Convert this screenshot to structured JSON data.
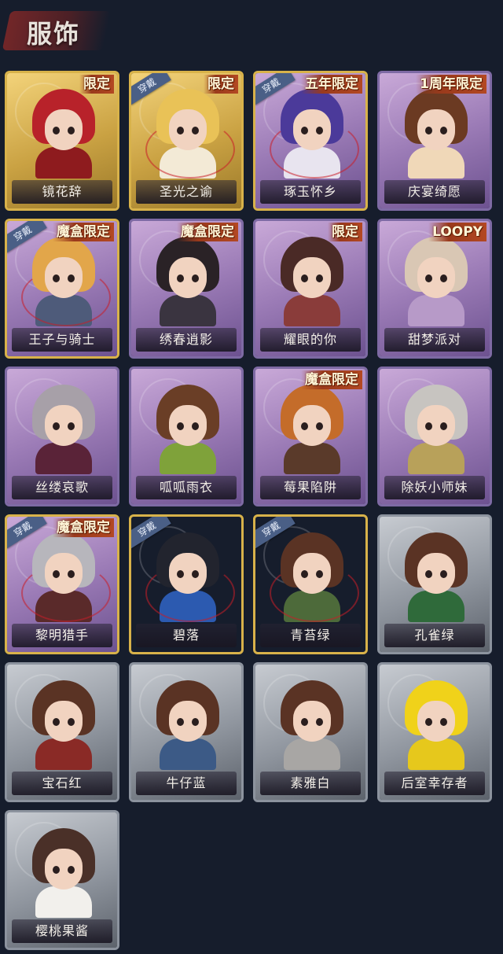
{
  "header": {
    "title": "服饰"
  },
  "items": [
    {
      "name": "镜花辞",
      "badge": "限定",
      "wearing": false,
      "frame": "gold",
      "bg": "gold",
      "hair": "#b8222a",
      "body": "#8e1b1e"
    },
    {
      "name": "圣光之谕",
      "badge": "限定",
      "wearing": true,
      "wear_label": "穿戴",
      "frame": "gold",
      "bg": "gold",
      "hair": "#e9c257",
      "body": "#f3ead6"
    },
    {
      "name": "琢玉怀乡",
      "badge": "五年限定",
      "wearing": true,
      "wear_label": "穿戴",
      "frame": "gold",
      "bg": "purple",
      "hair": "#4b3a9a",
      "body": "#e8e4ef"
    },
    {
      "name": "庆宴绮愿",
      "badge": "1周年限定",
      "wearing": false,
      "frame": "purple",
      "bg": "purple",
      "hair": "#6b3a22",
      "body": "#f0d8b8"
    },
    {
      "name": "王子与骑士",
      "badge": "魔盒限定",
      "wearing": true,
      "wear_label": "穿戴",
      "frame": "gold",
      "bg": "purple",
      "hair": "#e2a64a",
      "body": "#4e5b7a"
    },
    {
      "name": "绣春逍影",
      "badge": "魔盒限定",
      "wearing": false,
      "frame": "purple",
      "bg": "purple",
      "hair": "#2a2226",
      "body": "#3a3440"
    },
    {
      "name": "耀眼的你",
      "badge": "限定",
      "wearing": false,
      "frame": "purple",
      "bg": "purple",
      "hair": "#4a2a26",
      "body": "#8a3c3a"
    },
    {
      "name": "甜梦派对",
      "badge": "LOOPY",
      "wearing": false,
      "frame": "purple",
      "bg": "purple",
      "hair": "#d9c7b4",
      "body": "#b79ac8"
    },
    {
      "name": "丝缕哀歌",
      "badge": "",
      "wearing": false,
      "frame": "purple",
      "bg": "purple",
      "hair": "#a7a0a8",
      "body": "#5a2338"
    },
    {
      "name": "呱呱雨衣",
      "badge": "",
      "wearing": false,
      "frame": "purple",
      "bg": "purple",
      "hair": "#6a3e26",
      "body": "#7fa23a"
    },
    {
      "name": "莓果陷阱",
      "badge": "魔盒限定",
      "wearing": false,
      "frame": "purple",
      "bg": "purple",
      "hair": "#c46c2a",
      "body": "#5a3a2a"
    },
    {
      "name": "除妖小师妹",
      "badge": "",
      "wearing": false,
      "frame": "purple",
      "bg": "purple",
      "hair": "#c7c4c0",
      "body": "#b8a15a"
    },
    {
      "name": "黎明猎手",
      "badge": "魔盒限定",
      "wearing": true,
      "wear_label": "穿戴",
      "frame": "gold",
      "bg": "purple",
      "hair": "#b7b6bc",
      "body": "#5a2a2a"
    },
    {
      "name": "碧落",
      "badge": "",
      "wearing": true,
      "wear_label": "穿戴",
      "frame": "gold",
      "bg": "grey",
      "hair": "#22242e",
      "body": "#2c5ab0"
    },
    {
      "name": "青苔绿",
      "badge": "",
      "wearing": true,
      "wear_label": "穿戴",
      "frame": "gold",
      "bg": "grey",
      "hair": "#5a3324",
      "body": "#4d6a3a"
    },
    {
      "name": "孔雀绿",
      "badge": "",
      "wearing": false,
      "frame": "grey",
      "bg": "grey",
      "hair": "#5a3324",
      "body": "#2f6a3a"
    },
    {
      "name": "宝石红",
      "badge": "",
      "wearing": false,
      "frame": "grey",
      "bg": "grey",
      "hair": "#5a3324",
      "body": "#8a2a26"
    },
    {
      "name": "牛仔蓝",
      "badge": "",
      "wearing": false,
      "frame": "grey",
      "bg": "grey",
      "hair": "#5a3324",
      "body": "#3c5a86"
    },
    {
      "name": "素雅白",
      "badge": "",
      "wearing": false,
      "frame": "grey",
      "bg": "grey",
      "hair": "#5a3324",
      "body": "#a8a6a4"
    },
    {
      "name": "后室幸存者",
      "badge": "",
      "wearing": false,
      "frame": "grey",
      "bg": "grey",
      "hair": "#f0d21a",
      "body": "#e6c81c"
    },
    {
      "name": "樱桃果酱",
      "badge": "",
      "wearing": false,
      "frame": "grey",
      "bg": "grey",
      "hair": "#4a3028",
      "body": "#f2f0ec"
    }
  ]
}
